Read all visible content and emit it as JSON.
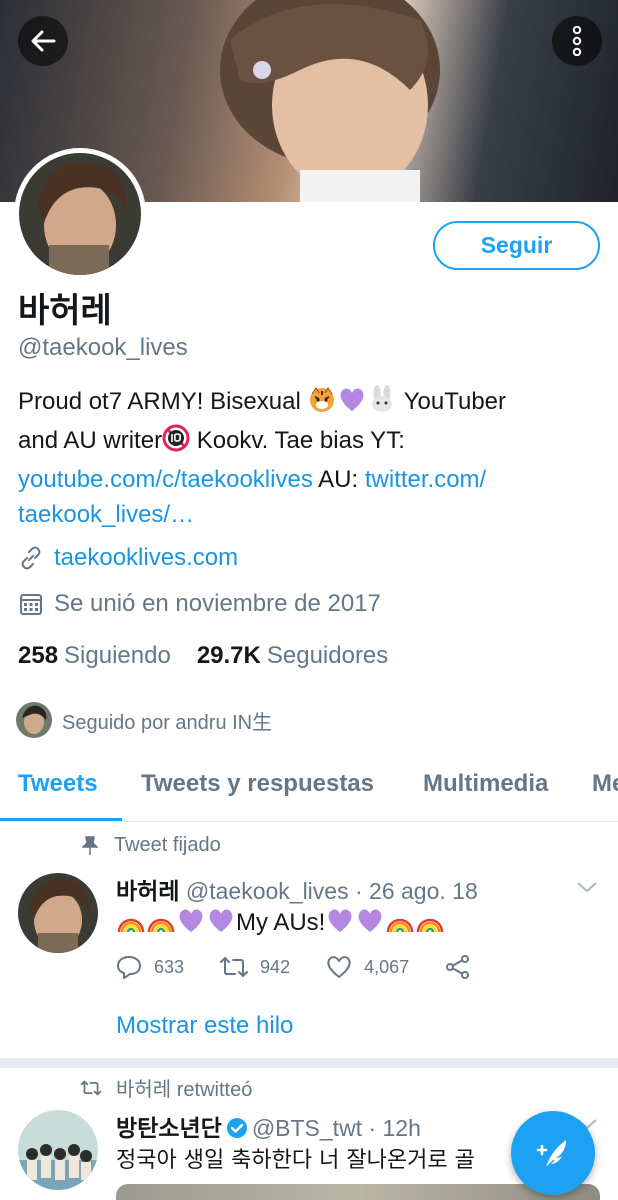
{
  "profile": {
    "display_name": "바허레",
    "handle": "@taekook_lives",
    "follow_label": "Seguir",
    "bio": {
      "line1_text": "Proud ot7 ARMY! Bisexual ",
      "line1_tail": " YouTuber",
      "line2_text": "and AU writer",
      "line2_tail": " Kookv. Tae bias YT:",
      "link1": "youtube.com/c/taekooklives",
      "mid": " AU: ",
      "link2_a": "twitter.com/",
      "link2_b": "taekook_lives/…"
    },
    "website": "taekooklives.com",
    "joined": "Se unió en noviembre de 2017",
    "following_count": "258",
    "following_label": "Siguiendo",
    "followers_count": "29.7K",
    "followers_label": "Seguidores",
    "followed_by": "Seguido por andru IN生"
  },
  "tabs": [
    "Tweets",
    "Tweets y respuestas",
    "Multimedia",
    "Me Gusta"
  ],
  "pinned_tweet": {
    "label": "Tweet fijado",
    "name": "바허레",
    "meta": "@taekook_lives · 26 ago. 18",
    "text": "My AUs!",
    "replies": "633",
    "retweets": "942",
    "likes": "4,067",
    "thread_link": "Mostrar este hilo"
  },
  "retweet": {
    "label": "바허레 retwitteó",
    "name": "방탄소년단",
    "meta": "@BTS_twt · 12h",
    "text": "정국아 생일 축하한다 너 잘나온거로 골"
  },
  "colors": {
    "accent": "#1da1f2",
    "link": "#1b95e0",
    "secondary_text": "#657786",
    "divider": "#e6ecf0"
  },
  "icons": [
    "back-arrow-icon",
    "more-vertical-icon",
    "link-icon",
    "calendar-icon",
    "pin-icon",
    "chevron-down-icon",
    "reply-icon",
    "retweet-icon",
    "like-icon",
    "share-icon",
    "verified-icon",
    "compose-icon"
  ]
}
